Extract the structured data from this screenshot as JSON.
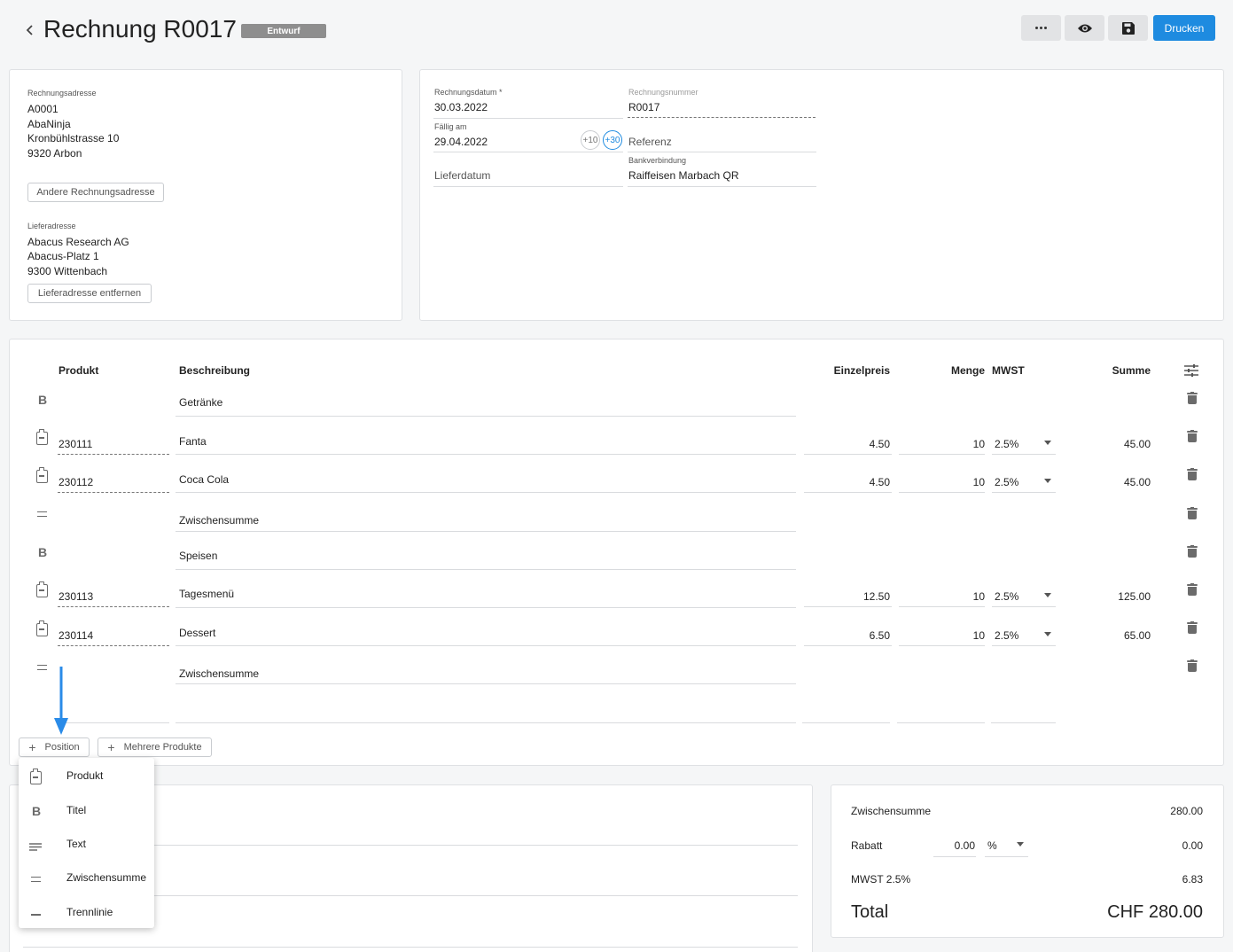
{
  "header": {
    "title": "Rechnung R0017",
    "status_badge": "Entwurf",
    "print_button": "Drucken",
    "accent_color": "#1e8be0"
  },
  "address_card": {
    "billing_label": "Rechnungsadresse",
    "billing_lines": [
      "A0001",
      "AbaNinja",
      "Kronbühlstrasse 10",
      "9320 Arbon"
    ],
    "other_billing_button": "Andere Rechnungsadresse",
    "delivery_label": "Lieferadresse",
    "delivery_lines": [
      "Abacus Research AG",
      "Abacus-Platz 1",
      "9300 Wittenbach"
    ],
    "remove_delivery_button": "Lieferadresse entfernen"
  },
  "details_card": {
    "invoice_date_label": "Rechnungsdatum *",
    "invoice_date_value": "30.03.2022",
    "invoice_number_label": "Rechnungsnummer",
    "invoice_number_value": "R0017",
    "due_label": "Fällig am",
    "due_value": "29.04.2022",
    "plus10": "+10",
    "plus30": "+30",
    "reference_placeholder": "Referenz",
    "delivery_date_placeholder": "Lieferdatum",
    "bank_label": "Bankverbindung",
    "bank_value": "Raiffeisen Marbach QR"
  },
  "positions": {
    "columns": {
      "product": "Produkt",
      "description": "Beschreibung",
      "unit_price": "Einzelpreis",
      "quantity": "Menge",
      "vat": "MWST",
      "sum": "Summe"
    },
    "rows": [
      {
        "type": "title",
        "icon": "bold-icon",
        "description": "Getränke"
      },
      {
        "type": "product",
        "icon": "clipboard-icon",
        "product": "230111",
        "description": "Fanta",
        "price": "4.50",
        "qty": "10",
        "vat": "2.5%",
        "sum": "45.00"
      },
      {
        "type": "product",
        "icon": "clipboard-icon",
        "product": "230112",
        "description": "Coca Cola",
        "price": "4.50",
        "qty": "10",
        "vat": "2.5%",
        "sum": "45.00"
      },
      {
        "type": "subtotal",
        "icon": "equals-icon",
        "description": "Zwischensumme"
      },
      {
        "type": "title",
        "icon": "bold-icon",
        "description": "Speisen"
      },
      {
        "type": "product",
        "icon": "clipboard-icon",
        "product": "230113",
        "description": "Tagesmenü",
        "price": "12.50",
        "qty": "10",
        "vat": "2.5%",
        "sum": "125.00"
      },
      {
        "type": "product",
        "icon": "clipboard-icon",
        "product": "230114",
        "description": "Dessert",
        "price": "6.50",
        "qty": "10",
        "vat": "2.5%",
        "sum": "65.00"
      },
      {
        "type": "subtotal",
        "icon": "equals-icon",
        "description": "Zwischensumme"
      }
    ],
    "add_position_button": "Position",
    "add_multiple_button": "Mehrere Produkte"
  },
  "add_menu": {
    "items": [
      {
        "icon": "clipboard-icon",
        "label": "Produkt"
      },
      {
        "icon": "bold-icon",
        "label": "Titel"
      },
      {
        "icon": "text-lines-icon",
        "label": "Text"
      },
      {
        "icon": "equals-icon",
        "label": "Zwischensumme"
      },
      {
        "icon": "divider-icon",
        "label": "Trennlinie"
      }
    ]
  },
  "totals": {
    "subtotal_label": "Zwischensumme",
    "subtotal_value": "280.00",
    "discount_label": "Rabatt",
    "discount_input": "0.00",
    "discount_unit": "%",
    "discount_value": "0.00",
    "vat_label": "MWST 2.5%",
    "vat_value": "6.83",
    "total_label": "Total",
    "total_value": "CHF 280.00"
  }
}
